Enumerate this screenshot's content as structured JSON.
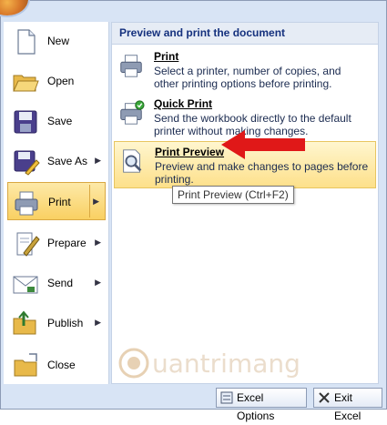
{
  "menu": {
    "items": [
      {
        "label": "New",
        "icon": "new-document-icon",
        "has_submenu": false
      },
      {
        "label": "Open",
        "icon": "open-folder-icon",
        "has_submenu": false
      },
      {
        "label": "Save",
        "icon": "save-disk-icon",
        "has_submenu": false
      },
      {
        "label": "Save As",
        "icon": "save-as-icon",
        "has_submenu": true
      },
      {
        "label": "Print",
        "icon": "printer-icon",
        "has_submenu": true,
        "active": true
      },
      {
        "label": "Prepare",
        "icon": "prepare-icon",
        "has_submenu": true
      },
      {
        "label": "Send",
        "icon": "send-icon",
        "has_submenu": true
      },
      {
        "label": "Publish",
        "icon": "publish-icon",
        "has_submenu": true
      },
      {
        "label": "Close",
        "icon": "close-folder-icon",
        "has_submenu": false
      }
    ]
  },
  "panel": {
    "header": "Preview and print the document",
    "items": [
      {
        "title": "Print",
        "desc": "Select a printer, number of copies, and other printing options before printing.",
        "icon": "printer-icon"
      },
      {
        "title": "Quick Print",
        "desc": "Send the workbook directly to the default printer without making changes.",
        "icon": "quick-print-icon"
      },
      {
        "title": "Print Preview",
        "desc": "Preview and make changes to pages before printing.",
        "icon": "print-preview-icon",
        "highlighted": true
      }
    ]
  },
  "tooltip": "Print Preview (Ctrl+F2)",
  "watermark": "Quantrimang",
  "footer": {
    "options_label": "Excel Options",
    "exit_label": "Exit Excel"
  },
  "colors": {
    "highlight": "#fde08a",
    "arrow": "#e01818",
    "header_text": "#15317e"
  }
}
